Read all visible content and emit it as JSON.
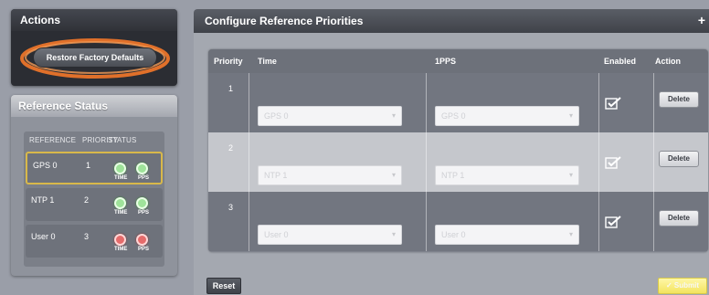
{
  "actions": {
    "title": "Actions",
    "restore_label": "Restore Factory Defaults"
  },
  "reference_status": {
    "title": "Reference Status",
    "headers": [
      "REFERENCE",
      "PRIORITY",
      "STATUS"
    ],
    "indicator_labels": {
      "time": "TIME",
      "pps": "PPS"
    },
    "rows": [
      {
        "name": "GPS 0",
        "priority": "1",
        "time_status": "green",
        "pps_status": "green"
      },
      {
        "name": "NTP 1",
        "priority": "2",
        "time_status": "green",
        "pps_status": "green"
      },
      {
        "name": "User 0",
        "priority": "3",
        "time_status": "red",
        "pps_status": "red"
      }
    ]
  },
  "configure": {
    "title": "Configure Reference Priorities",
    "plus": "+",
    "columns": [
      "Priority",
      "Time",
      "1PPS",
      "Enabled",
      "Action"
    ],
    "rows": [
      {
        "priority": "1",
        "time": "GPS 0",
        "pps": "GPS 0",
        "enabled": true,
        "action": "Delete"
      },
      {
        "priority": "2",
        "time": "NTP 1",
        "pps": "NTP 1",
        "enabled": true,
        "action": "Delete"
      },
      {
        "priority": "3",
        "time": "User 0",
        "pps": "User 0",
        "enabled": true,
        "action": "Delete"
      }
    ],
    "reset_label": "Reset",
    "submit_label": "✓ Submit"
  },
  "colors": {
    "status_green": "#9fe39a",
    "status_red": "#e56b6b",
    "submit_yellow": "#f3e45e",
    "ring_orange": "#e0702a"
  }
}
